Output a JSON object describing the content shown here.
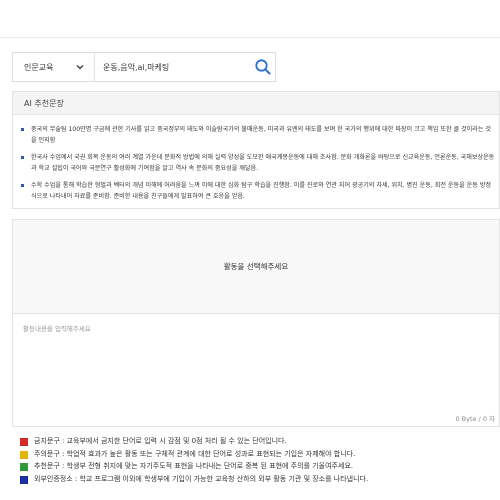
{
  "search": {
    "category_selected": "인문교육",
    "keyword_value": "운동,음악,ai,마케팅",
    "icon": "search-icon"
  },
  "ai_section": {
    "title": "AI 추천문장",
    "sentences": [
      "중국의 무술팀 100만명 구금에 관한 기사를 읽고 중국정부의 태도와 이슬람국가의 불매운동, 미국과 유엔의 태도를 보며 한 국가의 행위에 대한 파장이 크고 책임 또한 클 것이라는 것을 인지함",
      "한국사 수업에서 국권 회복 운동의 여러 계열 가운데 문화적 방법에 의해 실력 양성을 도모한 애국계몽운동에 대해 조사함. 문화 개화론을 바탕으로 신교육운동, 언론운동, 국채보상운동과 학교 설립이 국어와 국문연구 활성화에 기여함을 알고 역사 속 문화의 중요성을 깨달음.",
      "수학 수업을 통해 학습한 형벌과 벡터의 개념 이해에 어려움을 느껴 이에 대한 심화 탐구 학습을 진행함. 이를 진로와 연관 지어 광공기의 자세, 위치, 병진 운동, 회전 운동을 운동 방정식으로 나타내어 자료를 준비함. 준비한 내용을 친구들에게 발표하여 큰 호응을 얻음."
    ]
  },
  "activity": {
    "select_message": "활동을 선택해주세요",
    "content_placeholder": "활동내용을 입력해주세요",
    "byte_counter": "0 Byte / 0 자"
  },
  "legend": [
    {
      "color": "#d42a2a",
      "text": "금지문구 : 교육부에서 금지한 단어로 입력 시 감점 및 0점 처리 될 수 있는 단어입니다."
    },
    {
      "color": "#e0b400",
      "text": "주의문구 : 학업적 효과가 높은 활동 또는 구체적 관계에 대한 단어로 성과로 표현되는 기입은 자제해야 합니다."
    },
    {
      "color": "#2e9a3a",
      "text": "추천문구 : 학생부 전형 취지에 맞는 자기주도적 표현을 나타내는 단어로 중복 된 표현에 주의를 기울여주세요."
    },
    {
      "color": "#1c2f9c",
      "text": "외부인증정소 : 학교 프로그램 이외에 학생부에 기입이 가능한 교육청 산하의 외부 활동 기관 및 장소를 나타냅니다."
    }
  ]
}
